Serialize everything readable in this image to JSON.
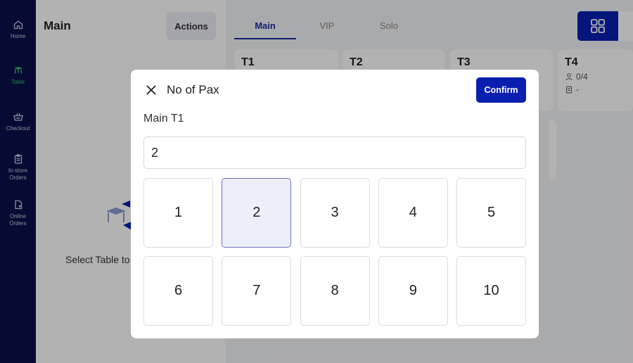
{
  "sidebar": {
    "items": [
      {
        "label_line1": "Home",
        "label_line2": "",
        "icon": "home-icon",
        "active": false
      },
      {
        "label_line1": "Table",
        "label_line2": "",
        "icon": "table-icon",
        "active": true
      },
      {
        "label_line1": "Checkout",
        "label_line2": "",
        "icon": "basket-icon",
        "active": false
      },
      {
        "label_line1": "In-store",
        "label_line2": "Orders",
        "icon": "clipboard-icon",
        "active": false
      },
      {
        "label_line1": "Online",
        "label_line2": "Orders",
        "icon": "online-orders-icon",
        "active": false
      }
    ]
  },
  "left_panel": {
    "title": "Main",
    "actions_label": "Actions",
    "empty_text": "Select Table to"
  },
  "tabs": [
    {
      "label": "Main",
      "active": true
    },
    {
      "label": "VIP",
      "active": false
    },
    {
      "label": "Solo",
      "active": false
    }
  ],
  "tables": [
    {
      "name": "T1"
    },
    {
      "name": "T2"
    },
    {
      "name": "T3"
    },
    {
      "name": "T4",
      "pax": "0/4",
      "order": "-"
    }
  ],
  "modal": {
    "title": "No of Pax",
    "confirm_label": "Confirm",
    "subtitle": "Main T1",
    "input_value": "2",
    "keys": [
      "1",
      "2",
      "3",
      "4",
      "5",
      "6",
      "7",
      "8",
      "9",
      "10"
    ],
    "selected_key": "2"
  },
  "colors": {
    "sidebar_bg": "#0b0f4a",
    "accent": "#0a1fb0",
    "active_nav": "#2bbf5a",
    "selected_key_bg": "#eceef9"
  }
}
